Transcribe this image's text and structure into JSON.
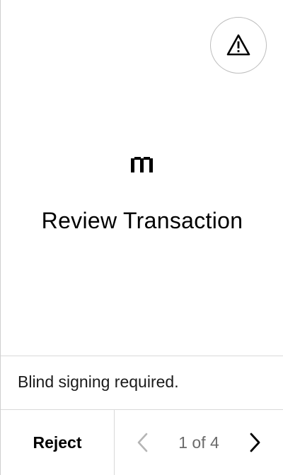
{
  "header": {
    "warning_icon": "warning-triangle-icon"
  },
  "main": {
    "logo_icon": "brand-logo-icon",
    "title": "Review Transaction"
  },
  "notice": {
    "text": "Blind signing required."
  },
  "footer": {
    "reject_label": "Reject",
    "pager": {
      "prev_icon": "chevron-left-icon",
      "next_icon": "chevron-right-icon",
      "indicator": "1 of 4",
      "current_page": 1,
      "total_pages": 4
    }
  },
  "colors": {
    "background": "#ffffff",
    "text": "#000000",
    "muted_text": "#6b6b6b",
    "divider": "#d9d9d9"
  }
}
